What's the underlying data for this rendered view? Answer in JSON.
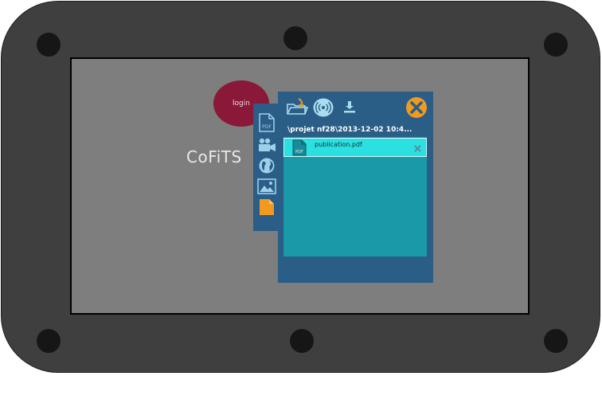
{
  "app": {
    "title": "CoFiTS"
  },
  "login": {
    "label": "login"
  },
  "sidebar": {
    "items": [
      {
        "name": "pdf",
        "icon": "pdf-document-icon",
        "label": "PDF"
      },
      {
        "name": "video",
        "icon": "video-camera-icon"
      },
      {
        "name": "web",
        "icon": "globe-icon"
      },
      {
        "name": "image",
        "icon": "image-icon"
      },
      {
        "name": "file",
        "icon": "file-icon",
        "active": true
      }
    ]
  },
  "toolbar": {
    "icons": [
      "open-folder-icon",
      "wireless-share-icon",
      "download-icon",
      "close-icon"
    ]
  },
  "browser": {
    "path": "\\projet nf28\\2013-12-02 10:4...",
    "files": [
      {
        "name": "publication.pdf",
        "type_label": "PDF",
        "icon": "pdf-file-icon",
        "selected": true
      }
    ]
  },
  "colors": {
    "frame": "#3f3f3f",
    "screen": "#7e7e7e",
    "login_button": "#8a1838",
    "panel": "#2a5e86",
    "list": "#1a99a8",
    "selected_row": "#2be0e0",
    "accent": "#f29a1f"
  }
}
